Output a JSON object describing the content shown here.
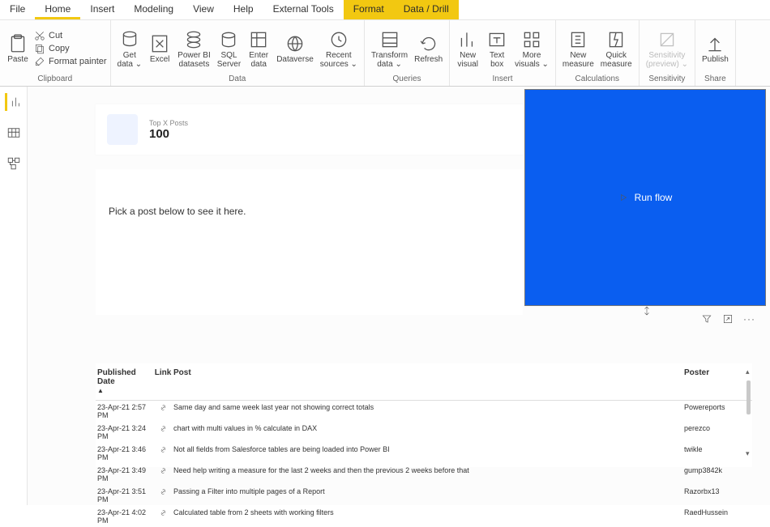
{
  "menu": {
    "items": [
      "File",
      "Home",
      "Insert",
      "Modeling",
      "View",
      "Help",
      "External Tools",
      "Format",
      "Data / Drill"
    ],
    "active_index": 1,
    "context_indices": [
      7,
      8
    ]
  },
  "ribbon": {
    "clipboard": {
      "label": "Clipboard",
      "paste": "Paste",
      "cut": "Cut",
      "copy": "Copy",
      "format_painter": "Format painter"
    },
    "data": {
      "label": "Data",
      "get_data": "Get\ndata ⌄",
      "excel": "Excel",
      "pbi_datasets": "Power BI\ndatasets",
      "sql_server": "SQL\nServer",
      "enter_data": "Enter\ndata",
      "dataverse": "Dataverse",
      "recent_sources": "Recent\nsources ⌄"
    },
    "queries": {
      "label": "Queries",
      "transform": "Transform\ndata ⌄",
      "refresh": "Refresh"
    },
    "insert": {
      "label": "Insert",
      "new_visual": "New\nvisual",
      "text_box": "Text\nbox",
      "more_visuals": "More\nvisuals ⌄"
    },
    "calculations": {
      "label": "Calculations",
      "new_measure": "New\nmeasure",
      "quick_measure": "Quick\nmeasure"
    },
    "sensitivity": {
      "label": "Sensitivity",
      "btn": "Sensitivity\n(preview) ⌄"
    },
    "share": {
      "label": "Share",
      "publish": "Publish"
    }
  },
  "card": {
    "title": "Top X Posts",
    "value": "100"
  },
  "note": {
    "message": "Pick a post below to see it here."
  },
  "runflow": {
    "label": "Run flow"
  },
  "vis_options_text": "",
  "table": {
    "headers": {
      "date": "Published Date",
      "link": "Link",
      "post": "Post",
      "poster": "Poster"
    },
    "rows": [
      {
        "date": "23-Apr-21 2:57 PM",
        "post": "Same day and same week last year not showing correct totals",
        "poster": "Powereports"
      },
      {
        "date": "23-Apr-21 3:24 PM",
        "post": "chart with multi values in % calculate in DAX",
        "poster": "perezco"
      },
      {
        "date": "23-Apr-21 3:46 PM",
        "post": "Not all fields from Salesforce tables are being loaded into Power BI",
        "poster": "twikle"
      },
      {
        "date": "23-Apr-21 3:49 PM",
        "post": "Need help writing a measure for the last 2 weeks and then the previous 2 weeks before that",
        "poster": "gump3842k"
      },
      {
        "date": "23-Apr-21 3:51 PM",
        "post": "Passing a Filter into multiple pages of a Report",
        "poster": "Razorbx13"
      },
      {
        "date": "23-Apr-21 4:02 PM",
        "post": "Calculated table from 2 sheets with working filters",
        "poster": "RaedHussein"
      }
    ]
  }
}
